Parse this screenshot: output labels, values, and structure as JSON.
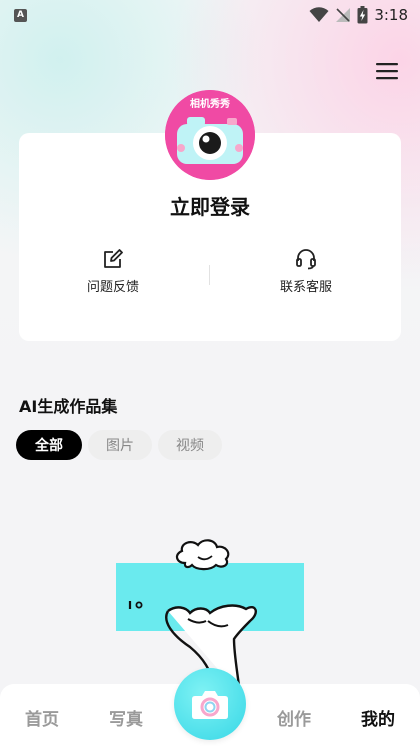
{
  "status_bar": {
    "app_badge": "A",
    "time": "3:18",
    "icons": [
      "wifi-icon",
      "signal-off-icon",
      "battery-charging-icon"
    ]
  },
  "header": {
    "menu_icon": "hamburger-menu-icon"
  },
  "profile": {
    "avatar_logo_text": "相机秀秀",
    "login_label": "立即登录",
    "actions": [
      {
        "label": "问题反馈",
        "icon": "feedback-edit-icon"
      },
      {
        "label": "联系客服",
        "icon": "headset-icon"
      }
    ]
  },
  "gallery": {
    "title": "AI生成作品集",
    "filters": [
      {
        "label": "全部",
        "active": true
      },
      {
        "label": "图片",
        "active": false
      },
      {
        "label": "视频",
        "active": false
      }
    ],
    "empty_illustration": "hand-holding-card-illustration"
  },
  "bottom_nav": {
    "items": [
      {
        "label": "首页",
        "active": false
      },
      {
        "label": "写真",
        "active": false
      },
      {
        "label": "创作",
        "active": false
      },
      {
        "label": "我的",
        "active": true
      }
    ],
    "center_button_icon": "camera-icon"
  },
  "colors": {
    "accent_cyan": "#37d7e6",
    "accent_pink": "#f04aa4",
    "active_tab": "#000000"
  }
}
